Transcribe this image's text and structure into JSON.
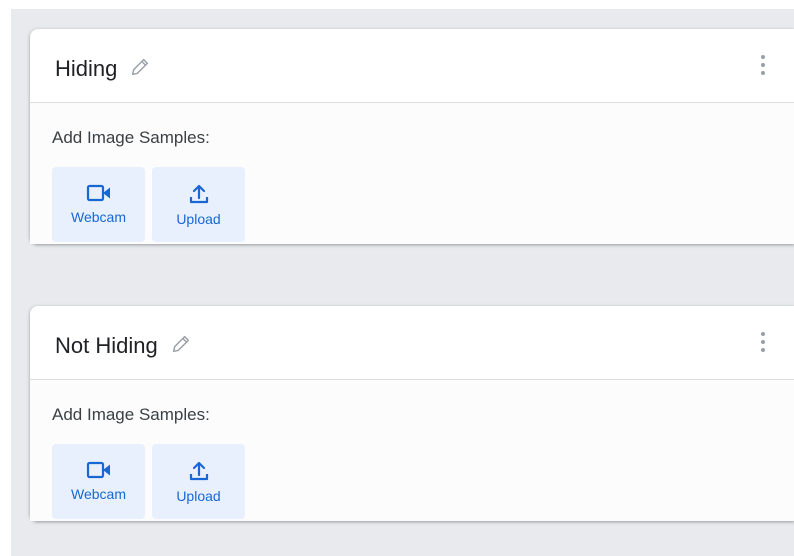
{
  "classes": [
    {
      "name": "Hiding",
      "samples_label": "Add Image Samples:",
      "webcam_label": "Webcam",
      "upload_label": "Upload"
    },
    {
      "name": "Not Hiding",
      "samples_label": "Add Image Samples:",
      "webcam_label": "Webcam",
      "upload_label": "Upload"
    }
  ],
  "colors": {
    "accent": "#1967d2",
    "button_bg": "#e8f0fe",
    "canvas_bg": "#e8eaed"
  },
  "icons": [
    "pencil-icon",
    "more-vert-icon",
    "videocam-icon",
    "upload-icon"
  ]
}
